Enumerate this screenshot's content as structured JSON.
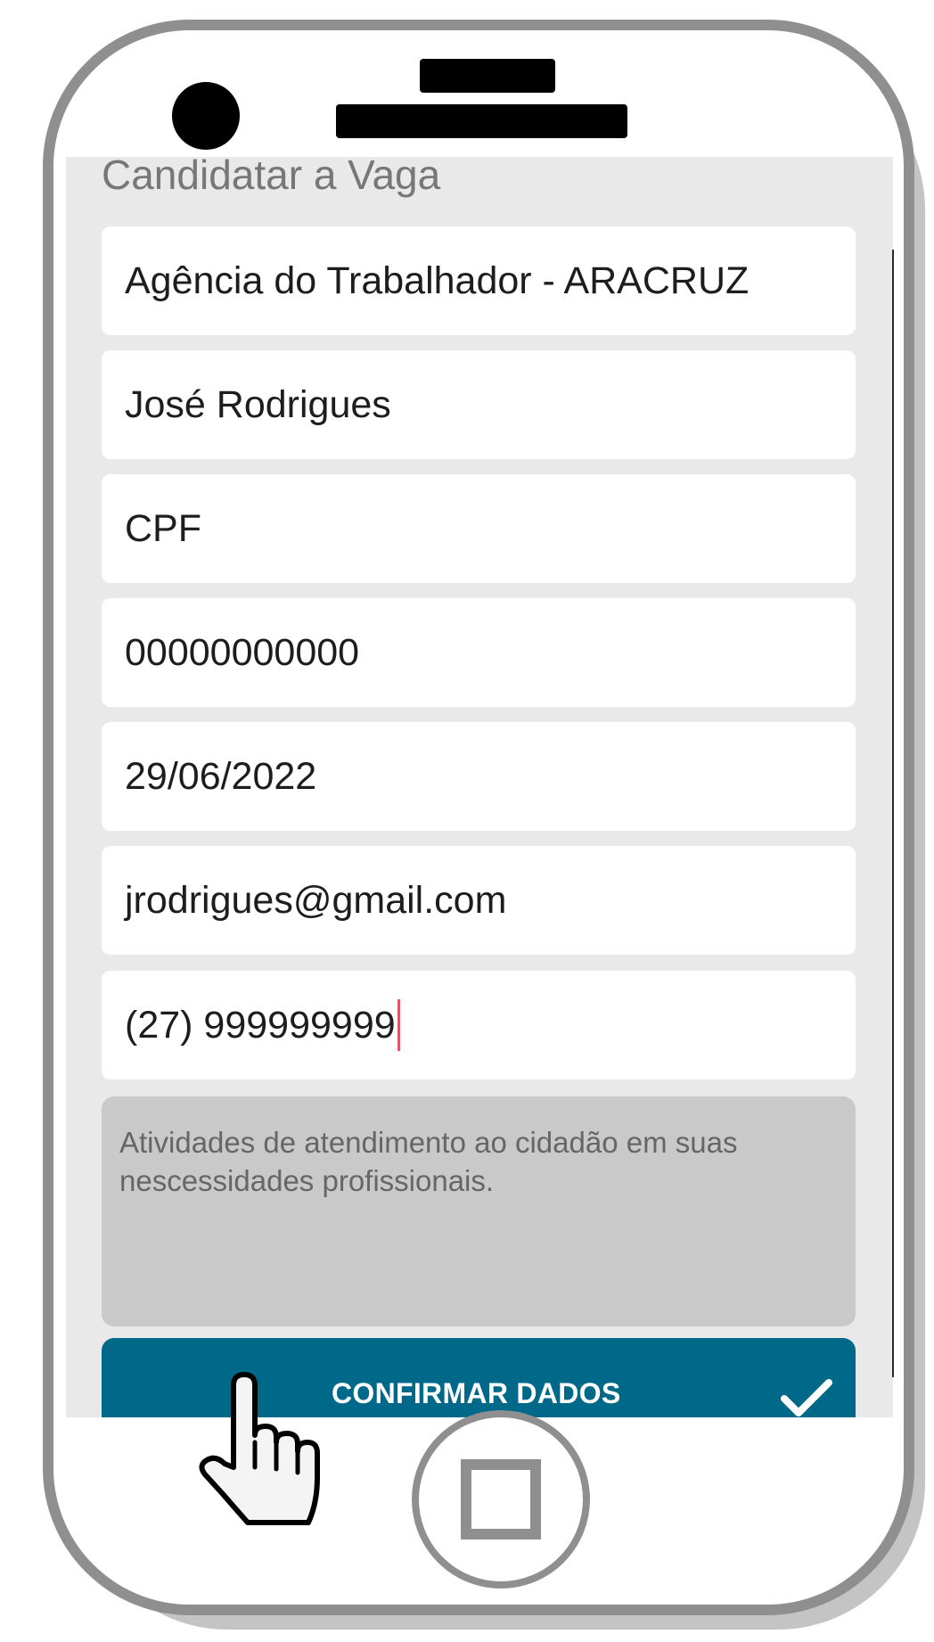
{
  "form": {
    "title": "Candidatar a Vaga",
    "agency": "Agência do Trabalhador - ARACRUZ",
    "name": "José Rodrigues",
    "document_type": "CPF",
    "document_number": "00000000000",
    "date": "29/06/2022",
    "email": "jrodrigues@gmail.com",
    "phone": "(27) 999999999",
    "description": "Atividades de atendimento ao cidadão em suas nescessidades profissionais.",
    "confirm_label": "CONFIRMAR DADOS"
  },
  "icons": {
    "confirm": "check-icon",
    "pointer": "hand-pointer-icon",
    "home": "home-button"
  },
  "colors": {
    "button": "#00698a",
    "caret": "#e0566a",
    "phone_frame": "#8f8f8f"
  }
}
